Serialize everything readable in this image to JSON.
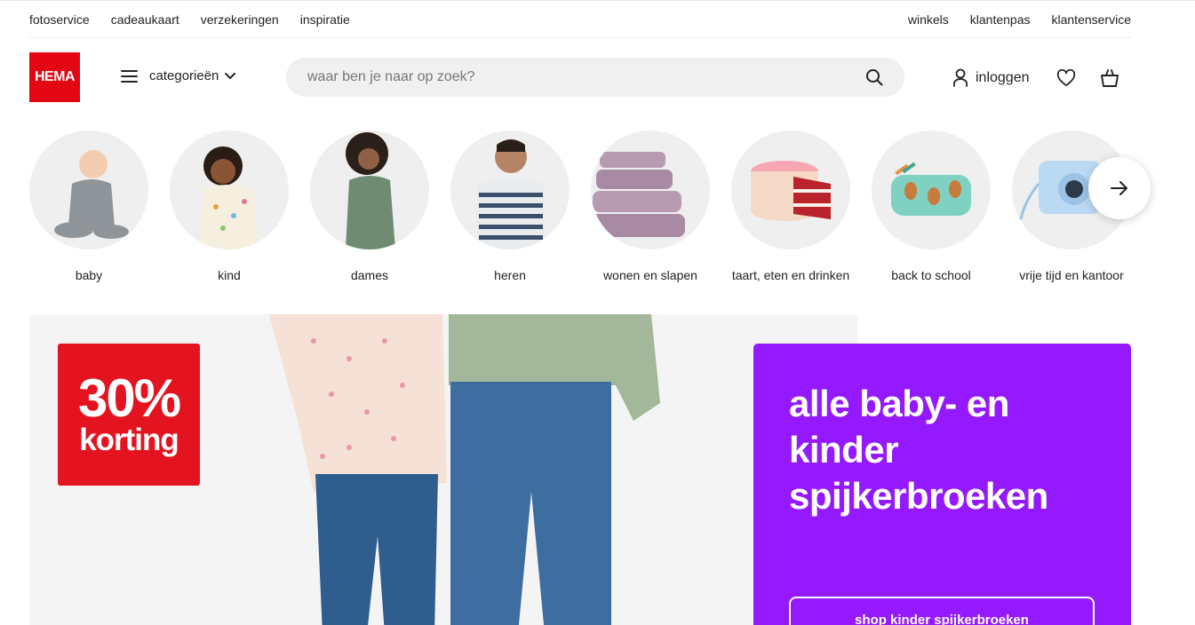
{
  "topbar": {
    "left_links": [
      "fotoservice",
      "cadeaukaart",
      "verzekeringen",
      "inspiratie"
    ],
    "right_links": [
      "winkels",
      "klantenpas",
      "klantenservice"
    ]
  },
  "header": {
    "logo_text": "HEMA",
    "categories_label": "categorieën",
    "search_placeholder": "waar ben je naar op zoek?",
    "login_label": "inloggen"
  },
  "categories": [
    {
      "label": "baby"
    },
    {
      "label": "kind"
    },
    {
      "label": "dames"
    },
    {
      "label": "heren"
    },
    {
      "label": "wonen en slapen"
    },
    {
      "label": "taart, eten en drinken"
    },
    {
      "label": "back to school"
    },
    {
      "label": "vrije tijd en kantoor"
    }
  ],
  "hero": {
    "badge_big": "30%",
    "badge_small": "korting"
  },
  "promo": {
    "title": "alle baby- en kinder spijkerbroeken",
    "cta": "shop kinder spijkerbroeken"
  },
  "colors": {
    "brand_red": "#e30613",
    "promo_purple": "#9419ff"
  }
}
